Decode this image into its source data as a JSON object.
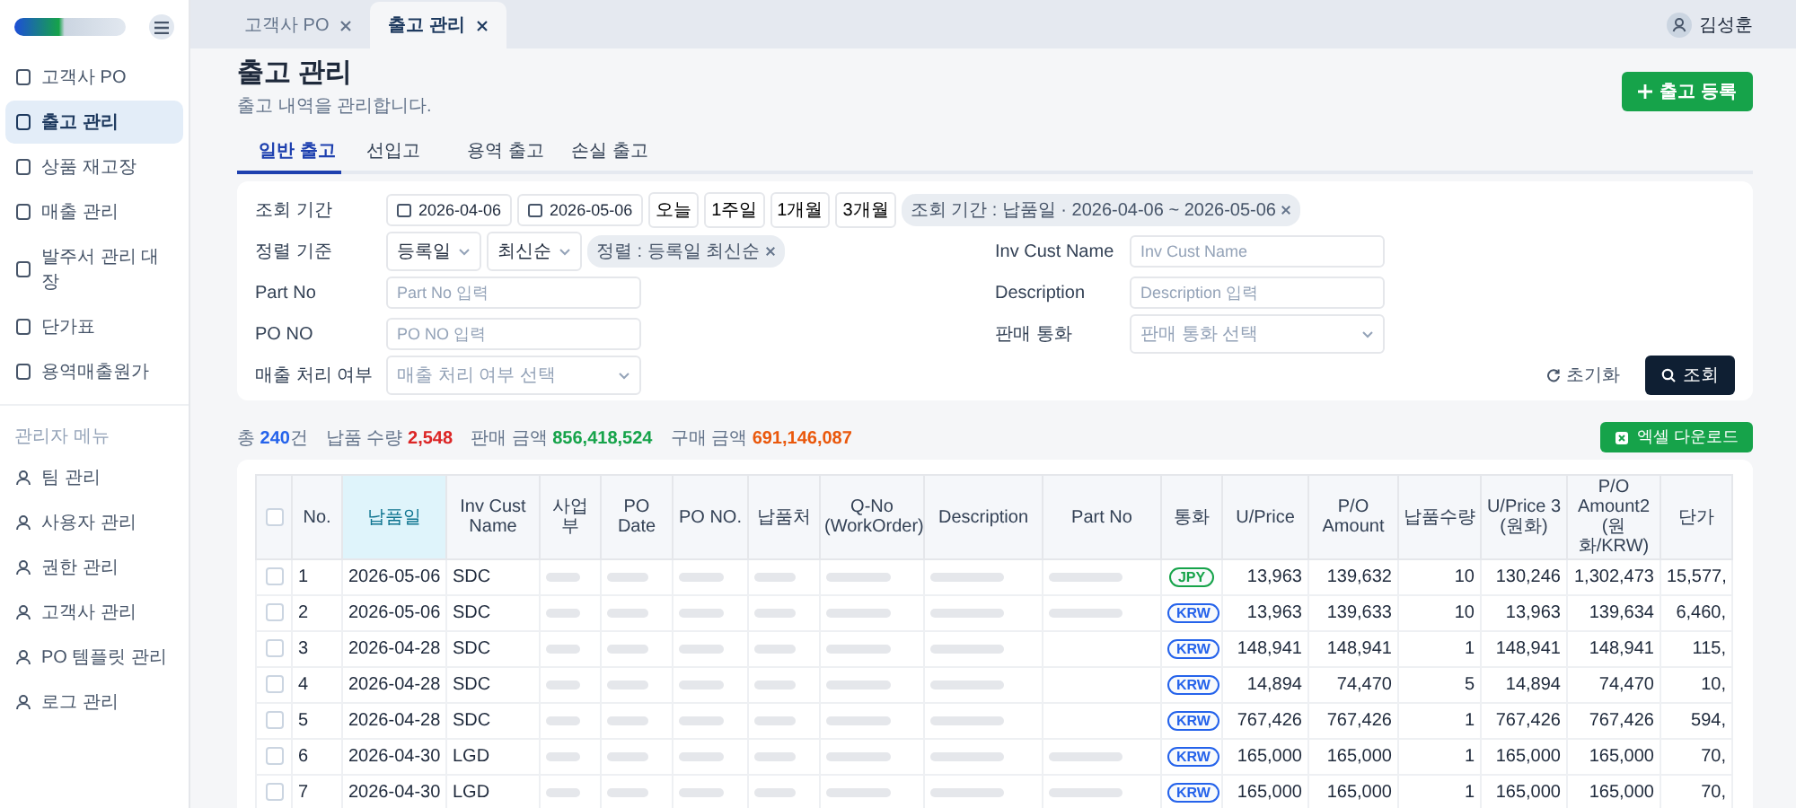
{
  "sidebar": {
    "items": [
      {
        "label": "고객사 PO",
        "selected": false
      },
      {
        "label": "출고 관리",
        "selected": true
      },
      {
        "label": "상품 재고장",
        "selected": false
      },
      {
        "label": "매출 관리",
        "selected": false
      },
      {
        "label": "발주서 관리 대장",
        "selected": false
      },
      {
        "label": "단가표",
        "selected": false
      },
      {
        "label": "용역매출원가",
        "selected": false
      }
    ],
    "section_title": "관리자 메뉴",
    "admin_items": [
      {
        "label": "팀 관리",
        "selected": false
      },
      {
        "label": "사용자 관리",
        "selected": false
      },
      {
        "label": "권한 관리",
        "selected": false
      },
      {
        "label": "고객사 관리",
        "selected": false
      },
      {
        "label": "PO 템플릿 관리",
        "selected": false
      },
      {
        "label": "로그 관리",
        "selected": false
      }
    ]
  },
  "tabs": [
    {
      "label": "고객사 PO",
      "selected": false
    },
    {
      "label": "출고 관리",
      "selected": true
    }
  ],
  "user": {
    "name": "김성훈"
  },
  "page": {
    "title": "출고 관리",
    "subtitle": "출고 내역을 관리합니다.",
    "add_button": "출고 등록"
  },
  "subtabs": [
    {
      "label": "일반 출고",
      "selected": true
    },
    {
      "label": "선입고",
      "selected": false
    },
    {
      "label": "용역 출고",
      "selected": false
    },
    {
      "label": "손실 출고",
      "selected": false
    }
  ],
  "filters": {
    "period": {
      "label": "조회 기간",
      "from": "2026-04-06",
      "to": "2026-05-06",
      "quick": [
        "오늘",
        "1주일",
        "1개월",
        "3개월"
      ],
      "chip": "조회 기간 : 납품일 · 2026-04-06 ~ 2026-05-06"
    },
    "sort": {
      "label": "정렬 기준",
      "field": "등록일",
      "order": "최신순",
      "chip": "정렬 : 등록일 최신순"
    },
    "left_fields": [
      {
        "label": "Part No",
        "placeholder": "Part No 입력",
        "kind": "text"
      },
      {
        "label": "PO NO",
        "placeholder": "PO NO 입력",
        "kind": "text"
      },
      {
        "label": "매출 처리 여부",
        "placeholder": "매출 처리 여부 선택",
        "kind": "select"
      }
    ],
    "right_fields": [
      {
        "label": "Inv Cust Name",
        "placeholder": "Inv Cust Name",
        "kind": "text"
      },
      {
        "label": "Description",
        "placeholder": "Description 입력",
        "kind": "text"
      },
      {
        "label": "판매 통화",
        "placeholder": "판매 통화 선택",
        "kind": "select"
      }
    ],
    "reset": "초기화",
    "search": "조회"
  },
  "summary": [
    {
      "label": "총",
      "value": "240",
      "unit": "건",
      "color": "#2563eb"
    },
    {
      "label": "납품 수량",
      "value": "2,548",
      "color": "#dc2626"
    },
    {
      "label": "판매 금액",
      "value": "856,418,524",
      "color": "#16a34a"
    },
    {
      "label": "구매 금액",
      "value": "691,146,087",
      "color": "#ea580c"
    }
  ],
  "excel_button": "엑셀 다운로드",
  "table": {
    "select_all_checked": false,
    "columns": [
      {
        "label": "No.",
        "sorted": false
      },
      {
        "label": "납품일",
        "sorted": true
      },
      {
        "label": "Inv Cust Name",
        "sorted": false
      },
      {
        "label": "사업부",
        "sorted": false
      },
      {
        "label": "PO Date",
        "sorted": false
      },
      {
        "label": "PO NO.",
        "sorted": false
      },
      {
        "label": "납품처",
        "sorted": false
      },
      {
        "label": "Q-No (WorkOrder)",
        "sorted": false
      },
      {
        "label": "Description",
        "sorted": false
      },
      {
        "label": "Part No",
        "sorted": false
      },
      {
        "label": "통화",
        "sorted": false
      },
      {
        "label": "U/Price",
        "sorted": false
      },
      {
        "label": "P/O Amount",
        "sorted": false
      },
      {
        "label": "납품수량",
        "sorted": false
      },
      {
        "label": "U/Price 3 (원화)",
        "sorted": false
      },
      {
        "label": "P/O Amount2 (원화/KRW)",
        "sorted": false
      },
      {
        "label": "단가",
        "sorted": false
      }
    ],
    "rows": [
      {
        "checked": false,
        "no": "1",
        "date": "2026-05-06",
        "cust": "SDC",
        "part_no_redacted": true,
        "currency": "JPY",
        "color": "#16a34a",
        "uprice": "13,963",
        "amount": "139,632",
        "qty": "10",
        "uprice3": "130,246",
        "amount2": "1,302,473",
        "unit": "15,577,"
      },
      {
        "checked": false,
        "no": "2",
        "date": "2026-05-06",
        "cust": "SDC",
        "part_no_redacted": true,
        "currency": "KRW",
        "color": "#2563eb",
        "uprice": "13,963",
        "amount": "139,633",
        "qty": "10",
        "uprice3": "13,963",
        "amount2": "139,634",
        "unit": "6,460,"
      },
      {
        "checked": false,
        "no": "3",
        "date": "2026-04-28",
        "cust": "SDC",
        "part_no_redacted": false,
        "currency": "KRW",
        "color": "#2563eb",
        "uprice": "148,941",
        "amount": "148,941",
        "qty": "1",
        "uprice3": "148,941",
        "amount2": "148,941",
        "unit": "115,"
      },
      {
        "checked": false,
        "no": "4",
        "date": "2026-04-28",
        "cust": "SDC",
        "part_no_redacted": false,
        "currency": "KRW",
        "color": "#2563eb",
        "uprice": "14,894",
        "amount": "74,470",
        "qty": "5",
        "uprice3": "14,894",
        "amount2": "74,470",
        "unit": "10,"
      },
      {
        "checked": false,
        "no": "5",
        "date": "2026-04-28",
        "cust": "SDC",
        "part_no_redacted": false,
        "currency": "KRW",
        "color": "#2563eb",
        "uprice": "767,426",
        "amount": "767,426",
        "qty": "1",
        "uprice3": "767,426",
        "amount2": "767,426",
        "unit": "594,"
      },
      {
        "checked": false,
        "no": "6",
        "date": "2026-04-30",
        "cust": "LGD",
        "part_no_redacted": true,
        "currency": "KRW",
        "color": "#2563eb",
        "uprice": "165,000",
        "amount": "165,000",
        "qty": "1",
        "uprice3": "165,000",
        "amount2": "165,000",
        "unit": "70,"
      },
      {
        "checked": false,
        "no": "7",
        "date": "2026-04-30",
        "cust": "LGD",
        "part_no_redacted": true,
        "currency": "KRW",
        "color": "#2563eb",
        "uprice": "165,000",
        "amount": "165,000",
        "qty": "1",
        "uprice3": "165,000",
        "amount2": "165,000",
        "unit": "70,"
      }
    ]
  }
}
